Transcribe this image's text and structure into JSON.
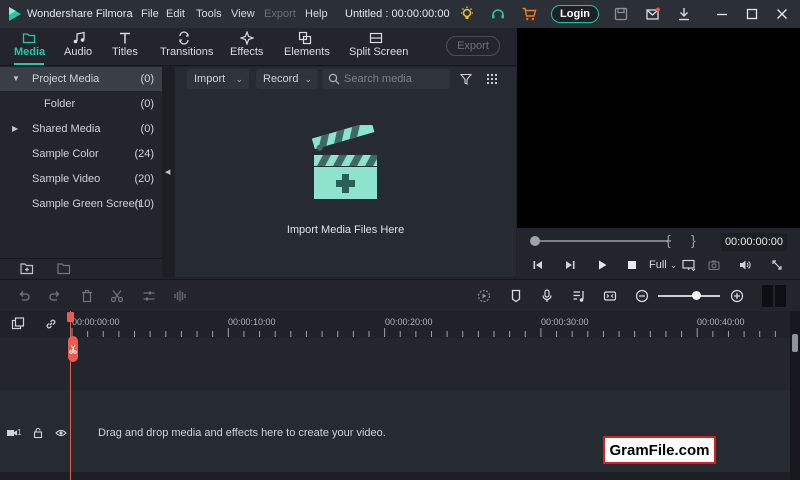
{
  "app": {
    "name": "Wondershare Filmora",
    "doc_title": "Untitled : 00:00:00:00",
    "login_label": "Login"
  },
  "menu": [
    "File",
    "Edit",
    "Tools",
    "View",
    "Export",
    "Help"
  ],
  "tabs": [
    {
      "label": "Media",
      "icon": "folder-icon",
      "active": true
    },
    {
      "label": "Audio",
      "icon": "music-note-icon"
    },
    {
      "label": "Titles",
      "icon": "text-t-icon"
    },
    {
      "label": "Transitions",
      "icon": "transition-icon"
    },
    {
      "label": "Effects",
      "icon": "sparkle-icon"
    },
    {
      "label": "Elements",
      "icon": "elements-icon"
    },
    {
      "label": "Split Screen",
      "icon": "split-screen-icon"
    }
  ],
  "export_label": "Export",
  "library": [
    {
      "name": "Project Media",
      "count": "(0)",
      "expanded": true
    },
    {
      "name": "Folder",
      "count": "(0)"
    },
    {
      "name": "Shared Media",
      "count": "(0)",
      "collapsed": true
    },
    {
      "name": "Sample Color",
      "count": "(24)"
    },
    {
      "name": "Sample Video",
      "count": "(20)"
    },
    {
      "name": "Sample Green Screen",
      "count": "(10)"
    }
  ],
  "media_toolbar": {
    "import_label": "Import",
    "record_label": "Record",
    "search_placeholder": "Search media"
  },
  "import_hint": "Import Media Files Here",
  "player": {
    "timecode": "00:00:00:00",
    "quality": "Full",
    "mark_in": "{",
    "mark_out": "}"
  },
  "ruler": [
    "00:00:00:00",
    "00:00:10:00",
    "00:00:20:00",
    "00:00:30:00",
    "00:00:40:00"
  ],
  "track": {
    "number": "1",
    "drop_hint": "Drag and drop media and effects here to create your video."
  },
  "zoom_level": 0.62,
  "colors": {
    "accent": "#20c7aa",
    "playhead": "#ef5a4f",
    "background": "#1f2329"
  },
  "watermark": "GramFile.com"
}
